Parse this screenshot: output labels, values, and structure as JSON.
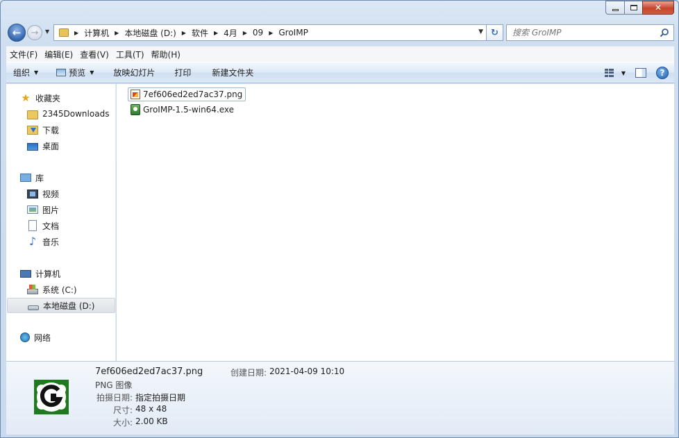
{
  "window": {
    "caption": {
      "close_label": "✕"
    }
  },
  "nav": {
    "back_glyph": "←",
    "forward_glyph": "→",
    "breadcrumbs": [
      "计算机",
      "本地磁盘 (D:)",
      "软件",
      "4月",
      "09",
      "GroIMP"
    ],
    "search_placeholder": "搜索 GroIMP"
  },
  "menu": [
    "文件(F)",
    "编辑(E)",
    "查看(V)",
    "工具(T)",
    "帮助(H)"
  ],
  "commands": {
    "organize": "组织",
    "preview": "预览",
    "slideshow": "放映幻灯片",
    "print": "打印",
    "new_folder": "新建文件夹",
    "help": "?"
  },
  "sidebar": {
    "favorites": {
      "label": "收藏夹",
      "items": [
        "2345Downloads",
        "下载",
        "桌面"
      ]
    },
    "libraries": {
      "label": "库",
      "items": [
        "视频",
        "图片",
        "文档",
        "音乐"
      ]
    },
    "computer": {
      "label": "计算机",
      "items": [
        "系统 (C:)",
        "本地磁盘 (D:)"
      ],
      "selected": "本地磁盘 (D:)"
    },
    "network": {
      "label": "网络"
    }
  },
  "files": [
    {
      "name": "7ef606ed2ed7ac37.png",
      "type": "png",
      "focused": true
    },
    {
      "name": "GroIMP-1.5-win64.exe",
      "type": "exe",
      "focused": false
    }
  ],
  "details": {
    "name": "7ef606ed2ed7ac37.png",
    "type": "PNG 图像",
    "created_label": "创建日期:",
    "created_value": "2021-04-09 10:10",
    "taken_label": "拍摄日期:",
    "taken_value": "指定拍摄日期",
    "dims_label": "尺寸:",
    "dims_value": "48 x 48",
    "size_label": "大小:",
    "size_value": "2.00 KB"
  },
  "colors": {
    "thumb_green": "#1f7a1f",
    "thumb_white": "#ffffff"
  }
}
